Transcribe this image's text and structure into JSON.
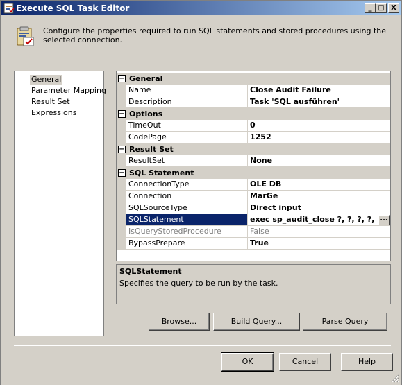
{
  "window": {
    "title": "Execute SQL Task Editor",
    "minimize_glyph": "_",
    "maximize_glyph": "□",
    "close_glyph": "X"
  },
  "header": {
    "description": "Configure the properties required to run SQL statements and stored procedures using the selected connection."
  },
  "nav": {
    "items": [
      {
        "label": "General",
        "selected": true
      },
      {
        "label": "Parameter Mapping",
        "selected": false
      },
      {
        "label": "Result Set",
        "selected": false
      },
      {
        "label": "Expressions",
        "selected": false
      }
    ]
  },
  "properties": {
    "categories": [
      {
        "label": "General",
        "toggle": "⊟",
        "rows": [
          {
            "name": "Name",
            "value": "Close Audit Failure"
          },
          {
            "name": "Description",
            "value": "Task 'SQL ausführen'"
          }
        ]
      },
      {
        "label": "Options",
        "toggle": "⊟",
        "rows": [
          {
            "name": "TimeOut",
            "value": "0"
          },
          {
            "name": "CodePage",
            "value": "1252"
          }
        ]
      },
      {
        "label": "Result Set",
        "toggle": "⊟",
        "rows": [
          {
            "name": "ResultSet",
            "value": "None"
          }
        ]
      },
      {
        "label": "SQL Statement",
        "toggle": "⊟",
        "rows": [
          {
            "name": "ConnectionType",
            "value": "OLE DB"
          },
          {
            "name": "Connection",
            "value": "MarGe"
          },
          {
            "name": "SQLSourceType",
            "value": "Direct input"
          },
          {
            "name": "SQLStatement",
            "value": "exec sp_audit_close ?, ?, ?, ?, 'FA",
            "selected": true,
            "ellipsis": "..."
          },
          {
            "name": "IsQueryStoredProcedure",
            "value": "False",
            "readonly": true
          },
          {
            "name": "BypassPrepare",
            "value": "True"
          }
        ]
      }
    ]
  },
  "description_panel": {
    "title": "SQLStatement",
    "text": "Specifies the query to be run by the task."
  },
  "actions": {
    "browse": "Browse...",
    "build_query": "Build Query...",
    "parse_query": "Parse Query"
  },
  "footer": {
    "ok": "OK",
    "cancel": "Cancel",
    "help": "Help"
  }
}
